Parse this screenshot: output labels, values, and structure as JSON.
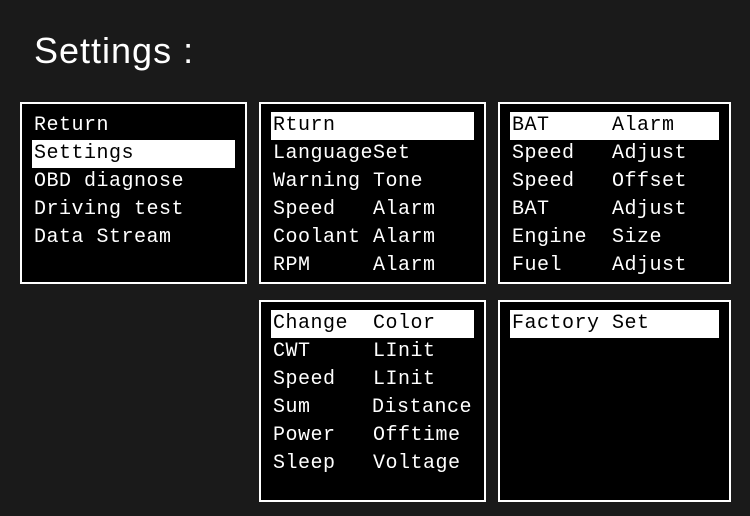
{
  "title": "Settings :",
  "panels": {
    "p1": {
      "items": [
        {
          "label": "Return",
          "selected": false
        },
        {
          "label": "Settings",
          "selected": true
        },
        {
          "label": "OBD diagnose",
          "selected": false
        },
        {
          "label": "Driving test",
          "selected": false
        },
        {
          "label": "Data Stream",
          "selected": false
        }
      ]
    },
    "p2": {
      "items": [
        {
          "c1": "Rturn",
          "c2": "",
          "selected": true
        },
        {
          "c1": "Language",
          "c2": "Set",
          "selected": false
        },
        {
          "c1": "Warning",
          "c2": "Tone",
          "selected": false
        },
        {
          "c1": "Speed",
          "c2": "Alarm",
          "selected": false
        },
        {
          "c1": "Coolant",
          "c2": "Alarm",
          "selected": false
        },
        {
          "c1": "RPM",
          "c2": "Alarm",
          "selected": false
        }
      ]
    },
    "p3": {
      "items": [
        {
          "c1": "BAT",
          "c2": "Alarm",
          "selected": true
        },
        {
          "c1": "Speed",
          "c2": "Adjust",
          "selected": false
        },
        {
          "c1": "Speed",
          "c2": "Offset",
          "selected": false
        },
        {
          "c1": "BAT",
          "c2": "Adjust",
          "selected": false
        },
        {
          "c1": "Engine",
          "c2": "Size",
          "selected": false
        },
        {
          "c1": "Fuel",
          "c2": "Adjust",
          "selected": false
        }
      ]
    },
    "p4": {
      "items": [
        {
          "c1": "Change",
          "c2": "Color",
          "selected": true
        },
        {
          "c1": "CWT",
          "c2": "LInit",
          "selected": false
        },
        {
          "c1": "Speed",
          "c2": "LInit",
          "selected": false
        },
        {
          "c1": "Sum",
          "c2": "Distance",
          "selected": false
        },
        {
          "c1": "Power",
          "c2": "Offtime",
          "selected": false
        },
        {
          "c1": "Sleep",
          "c2": "Voltage",
          "selected": false
        }
      ]
    },
    "p5": {
      "items": [
        {
          "c1": "Factory",
          "c2": "Set",
          "selected": true
        }
      ]
    }
  }
}
